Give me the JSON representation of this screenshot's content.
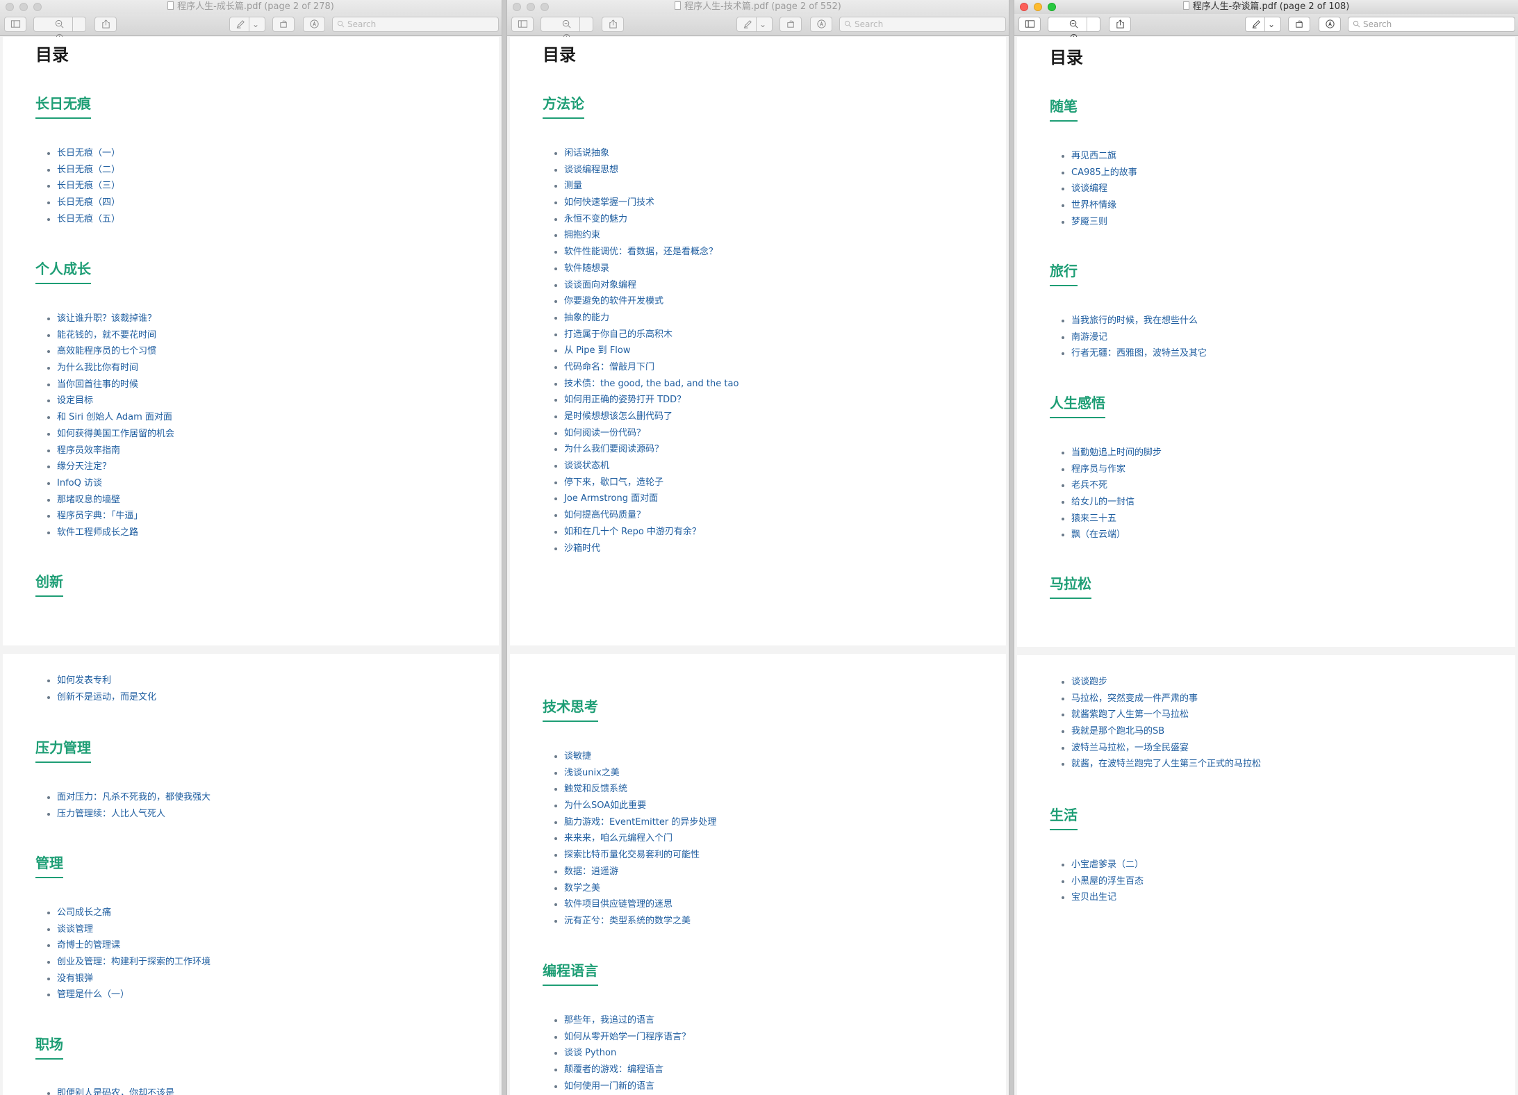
{
  "windows": [
    {
      "title": "程序人生-成长篇.pdf (page 2 of 278)",
      "search_placeholder": "Search",
      "toc_title": "目录",
      "s0": "长日无痕",
      "l0": [
        "长日无痕（一）",
        "长日无痕（二）",
        "长日无痕（三）",
        "长日无痕（四）",
        "长日无痕（五）"
      ],
      "s1": "个人成长",
      "l1": [
        "该让谁升职？该裁掉谁？",
        "能花钱的，就不要花时间",
        "高效能程序员的七个习惯",
        "为什么我比你有时间",
        "当你回首往事的时候",
        "设定目标",
        "和 Siri 创始人 Adam 面对面",
        "如何获得美国工作居留的机会",
        "程序员效率指南",
        "缘分天注定？",
        "InfoQ 访谈",
        "那堵叹息的墙壁",
        "程序员字典：「牛逼」",
        "软件工程师成长之路"
      ],
      "s2": "创新",
      "l2": [
        "如何发表专利",
        "创新不是运动，而是文化"
      ],
      "s3": "压力管理",
      "l3": [
        "面对压力：凡杀不死我的，都使我强大",
        "压力管理续：人比人气死人"
      ],
      "s4": "管理",
      "l4": [
        "公司成长之痛",
        "谈谈管理",
        "奇博士的管理课",
        "创业及管理：构建利于探索的工作环境",
        "没有银弹",
        "管理是什么（一）"
      ],
      "s5": "职场",
      "l5": [
        "即便别人是码农，你却不该是"
      ]
    },
    {
      "title": "程序人生-技术篇.pdf (page 2 of 552)",
      "search_placeholder": "Search",
      "toc_title": "目录",
      "s0": "方法论",
      "l0": [
        "闲话说抽象",
        "谈谈编程思想",
        "测量",
        "如何快速掌握一门技术",
        "永恒不变的魅力",
        "拥抱约束",
        "软件性能调优：看数据，还是看概念？",
        "软件随想录",
        "谈谈面向对象编程",
        "你要避免的软件开发模式",
        "抽象的能力",
        "打造属于你自己的乐高积木",
        "从 Pipe 到 Flow",
        "代码命名：僧敲月下门",
        "技术债：the good, the bad, and the tao",
        "如何用正确的姿势打开 TDD？",
        "是时候想想该怎么删代码了",
        "如何阅读一份代码？",
        "为什么我们要阅读源码？",
        "谈谈状态机",
        "停下来，歇口气，造轮子",
        "Joe Armstrong 面对面",
        "如何提高代码质量？",
        "如和在几十个 Repo 中游刃有余？",
        "沙箱时代"
      ],
      "s1": "技术思考",
      "l1": [
        "谈敏捷",
        "浅谈unix之美",
        "触觉和反馈系统",
        "为什么SOA如此重要",
        "脑力游戏：EventEmitter 的异步处理",
        "来来来，咱么元编程入个门",
        "探索比特币量化交易套利的可能性",
        "数据：逍遥游",
        "数学之美",
        "软件项目供应链管理的迷思",
        "沅有芷兮：类型系统的数学之美"
      ],
      "s2": "编程语言",
      "l2": [
        "那些年，我追过的语言",
        "如何从零开始学一门程序语言？",
        "谈谈 Python",
        "颠覆者的游戏：编程语言",
        "如何使用一门新的语言"
      ]
    },
    {
      "title": "程序人生-杂谈篇.pdf (page 2 of 108)",
      "search_placeholder": "Search",
      "toc_title": "目录",
      "s0": "随笔",
      "l0": [
        "再见西二旗",
        "CA985上的故事",
        "谈谈编程",
        "世界杯情缘",
        "梦魇三则"
      ],
      "s1": "旅行",
      "l1": [
        "当我旅行的时候，我在想些什么",
        "南游漫记",
        "行者无疆：西雅图，波特兰及其它"
      ],
      "s2": "人生感悟",
      "l2": [
        "当勤勉追上时间的脚步",
        "程序员与作家",
        "老兵不死",
        "给女儿的一封信",
        "猿来三十五",
        "飘（在云端）"
      ],
      "s3": "马拉松",
      "l3": [
        "谈谈跑步",
        "马拉松，突然变成一件严肃的事",
        "就酱紫跑了人生第一个马拉松",
        "我就是那个跑北马的SB",
        "波特兰马拉松，一场全民盛宴",
        "就酱，在波特兰跑完了人生第三个正式的马拉松"
      ],
      "s4": "生活",
      "l4": [
        "小宝虐爹录（二）",
        "小黑屋的浮生百态",
        "宝贝出生记"
      ]
    }
  ],
  "colors": {
    "heading": "#1e9e75",
    "link": "#1f5ea0"
  }
}
